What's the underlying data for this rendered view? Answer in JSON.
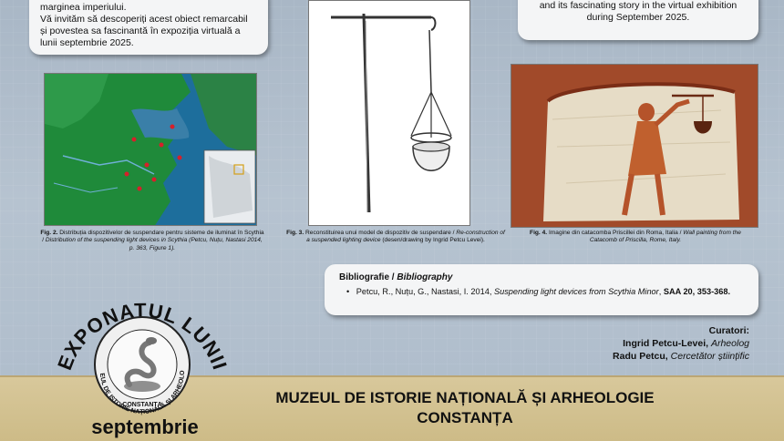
{
  "intro": {
    "lines": [
      "marginea imperiului.",
      "Vă invităm să descoperiți acest obiect remarcabil și povestea sa fascinantă în expoziția virtuală a lunii septembrie 2025."
    ]
  },
  "intro_en": {
    "lines": [
      "and its fascinating story in the virtual exhibition",
      "during September 2025."
    ]
  },
  "figures": {
    "fig2": {
      "label": "Fig. 2.",
      "text_ro": "Distribuția dispozitivelor de suspendare pentru sisteme de iluminat în Scythia /",
      "text_en": "Distribution of the suspending light devices in Scythia (Petcu, Nuțu, Nastasi 2014, p. 363, Figure 1)."
    },
    "fig3": {
      "label": "Fig. 3.",
      "text_ro": "Reconstituirea unui model de dispozitiv de suspendare /",
      "text_en": "Re-construction of a suspended lighting device",
      "credit": "(desen/drawing by Ingrid Petcu Levei)."
    },
    "fig4": {
      "label": "Fig. 4.",
      "text_ro": "Imagine din catacomba Priscillei din Roma, Italia /",
      "text_en": "Wall painting from the Catacomb of Priscilla, Rome, Italy."
    }
  },
  "bibliography": {
    "title_ro": "Bibliografie /",
    "title_en": "Bibliography",
    "entry_authors": "Petcu, R., Nuțu, G., Nastasi, I. 2014,",
    "entry_title": "Suspending light devices from Scythia Minor",
    "entry_source": "SAA 20, 353-368."
  },
  "curators": {
    "heading": "Curatori:",
    "people": [
      {
        "name": "Ingrid Petcu-Levei,",
        "role": "Arheolog"
      },
      {
        "name": "Radu Petcu,",
        "role": "Cercetător științific"
      }
    ]
  },
  "logo": {
    "arc_text": "EXPONATUL LUNII",
    "ring_text": "MUZEUL DE ISTORIE NAȚIONALĂ ȘI ARHEOLOGIE",
    "city": "CONSTANȚA",
    "month": "septembrie"
  },
  "footer": {
    "line1": "MUZEUL DE ISTORIE NAȚIONALĂ ȘI ARHEOLOGIE",
    "line2": "CONSTANȚA"
  },
  "colors": {
    "background": "#aebccb",
    "band": "#d2c08e",
    "fresco": "#a14a2a",
    "map_sea": "#1d6e9c",
    "map_land": "#1f8a3a"
  }
}
